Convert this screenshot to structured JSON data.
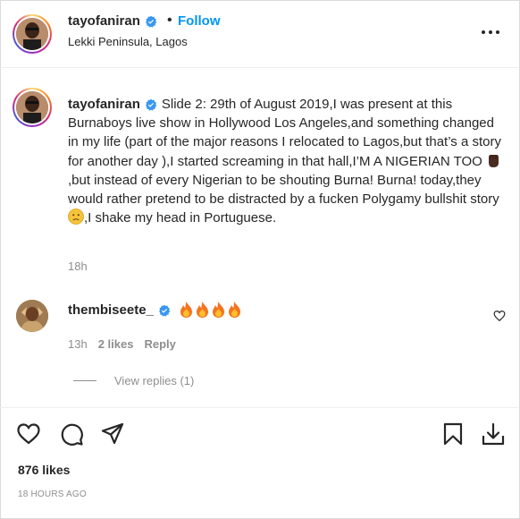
{
  "header": {
    "username": "tayofaniran",
    "follow_label": "Follow",
    "separator": "•",
    "location": "Lekki Peninsula, Lagos",
    "more_icon": "more-horizontal-icon"
  },
  "caption": {
    "username": "tayofaniran",
    "text_part1": "Slide 2: 29th of August 2019,I was present at this Burnaboys live show in Hollywood Los Angeles,and something changed in my life (part of the major reasons I relocated to Lagos,but that’s a story for another day ),I started screaming in that hall,I’M A NIGERIAN TOO ",
    "text_part2": ",but instead of every Nigerian to be shouting Burna! Burna! today,they would rather pretend to be distracted by a fucken Polygamy bullshit story ",
    "text_part3": ",I shake my head in Portuguese.",
    "time": "18h"
  },
  "comment": {
    "username": "thembiseete_",
    "fire_count": 4,
    "time": "13h",
    "likes": "2 likes",
    "reply_label": "Reply",
    "view_replies": "View replies (1)"
  },
  "actions": {
    "icons": [
      "heart-icon",
      "comment-icon",
      "share-icon",
      "bookmark-icon",
      "download-icon"
    ]
  },
  "footer": {
    "likes": "876 likes",
    "posted": "18 HOURS AGO"
  },
  "colors": {
    "link_blue": "#0095f6",
    "verified_blue": "#3897f0",
    "muted": "#8e8e8e",
    "text": "#262626"
  }
}
